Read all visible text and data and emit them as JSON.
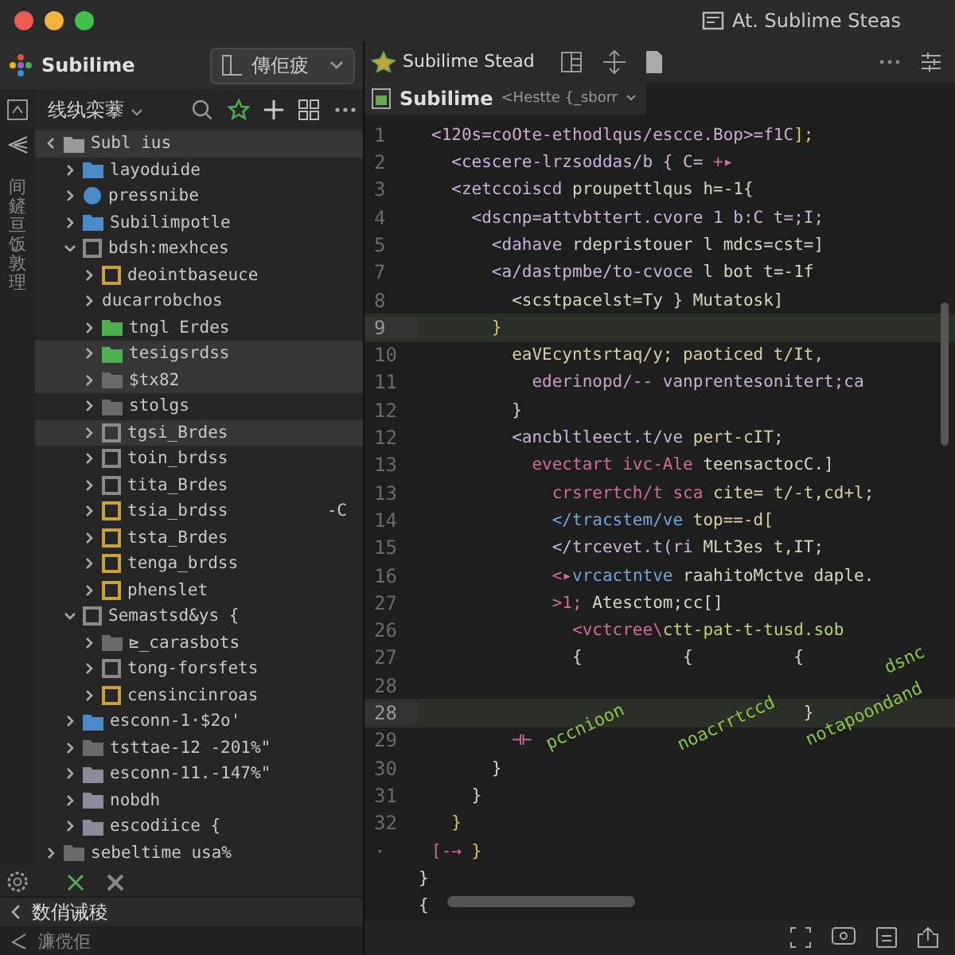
{
  "window": {
    "title": "At. Sublime Steas"
  },
  "sidebar": {
    "app_name": "Subilime",
    "switcher": {
      "label": "傳佢疲"
    },
    "section": {
      "label": "线纨栾藆"
    },
    "activity_label": "间鏟亘饭敦理",
    "tree": [
      {
        "label": "Subl ius",
        "kind": "root",
        "color": "#9a9a9a",
        "selected": true,
        "expanded": true,
        "children": [
          {
            "label": "layoduide",
            "kind": "folder",
            "color": "#4a8cc9",
            "selected": false,
            "expanded": false
          },
          {
            "label": "pressnibe",
            "kind": "dot",
            "color": "#4a8cc9",
            "selected": false,
            "expanded": false
          },
          {
            "label": "Subilimpotle",
            "kind": "folder",
            "color": "#4a8cc9",
            "selected": false,
            "expanded": false
          },
          {
            "label": "bdsh:mexhces",
            "kind": "outline",
            "color": "#8a8a8a",
            "selected": false,
            "expanded": true,
            "children": [
              {
                "label": "deointbaseuce",
                "kind": "outline",
                "color": "#c9a13b",
                "selected": false,
                "expanded": false
              },
              {
                "label": "ducarrobchos",
                "kind": "none",
                "selected": false,
                "expanded": false
              },
              {
                "label": "tngl Erdes",
                "kind": "folder",
                "color": "#4caf50",
                "selected": false,
                "expanded": false
              },
              {
                "label": "tesigsrdss",
                "kind": "folder",
                "color": "#4caf50",
                "selected": true,
                "expanded": false
              },
              {
                "label": "$tx82",
                "kind": "folder",
                "color": "#6a6a6a",
                "selected": true,
                "expanded": false
              },
              {
                "label": "stolgs",
                "kind": "folder",
                "color": "#6a6a6a",
                "selected": false,
                "expanded": false
              },
              {
                "label": "tgsi_Brdes",
                "kind": "outline",
                "color": "#8a8a8a",
                "selected": true,
                "expanded": false
              },
              {
                "label": "toin_brdss",
                "kind": "outline",
                "color": "#8a8a8a",
                "selected": false,
                "expanded": false
              },
              {
                "label": "tita_Brdes",
                "kind": "outline",
                "color": "#8a8a8a",
                "selected": false,
                "expanded": false
              },
              {
                "label": "tsia_brdss",
                "kind": "outline",
                "color": "#c9a13b",
                "selected": false,
                "expanded": false,
                "badge": "-C"
              },
              {
                "label": "tsta_Brdes",
                "kind": "outline",
                "color": "#c9a13b",
                "selected": false,
                "expanded": false
              },
              {
                "label": "tenga_brdss",
                "kind": "outline",
                "color": "#c9a13b",
                "selected": false,
                "expanded": false
              },
              {
                "label": "phenslet",
                "kind": "outline",
                "color": "#c9a13b",
                "selected": false,
                "expanded": false
              }
            ]
          },
          {
            "label": "Semastsd&ys {",
            "kind": "outline",
            "color": "#8a8a8a",
            "selected": false,
            "expanded": true,
            "children": [
              {
                "label": "⊵_carasbots",
                "kind": "folder",
                "color": "#6a6a6a",
                "selected": false,
                "expanded": false
              },
              {
                "label": "tong-forsfets",
                "kind": "outline",
                "color": "#8a8a8a",
                "selected": false,
                "expanded": false
              },
              {
                "label": "censincinroas",
                "kind": "outline",
                "color": "#c9a13b",
                "selected": false,
                "expanded": false
              }
            ]
          },
          {
            "label": "esconn-1·$2o'",
            "kind": "folder",
            "color": "#4a8cc9",
            "selected": false,
            "expanded": false
          },
          {
            "label": "tsttae-12 -201%\"",
            "kind": "folder",
            "color": "#6a6a6a",
            "selected": false,
            "expanded": false
          },
          {
            "label": "esconn-11.-147%\"",
            "kind": "folder",
            "color": "#8a8a9a",
            "selected": false,
            "expanded": false
          },
          {
            "label": "nobdh",
            "kind": "folder",
            "color": "#8a8a9a",
            "selected": false,
            "expanded": false
          },
          {
            "label": "escodiice {",
            "kind": "folder",
            "color": "#8a8a9a",
            "selected": false,
            "expanded": false
          }
        ]
      },
      {
        "label": "sebeltime usa%",
        "kind": "folder",
        "color": "#6a6a6a",
        "selected": false,
        "expanded": false
      }
    ],
    "panel_tab": "数俏诫稜",
    "status": "濂傥佢"
  },
  "editor": {
    "tab": "Subilime Stead",
    "breadcrumb": {
      "file": "Subilime",
      "path": "<Hestte {_sborr"
    },
    "lines": [
      {
        "num": "1",
        "current": false,
        "tokens": [
          {
            "text": "<120s=coOte-ethodlqus/escce.Bop>=f1C",
            "color": "#d0a8d0"
          },
          {
            "text": "];",
            "color": "#d9c46a"
          }
        ]
      },
      {
        "num": "2",
        "current": false,
        "tokens": [
          {
            "text": "  <cescere-lrzsoddas/b { C=",
            "color": "#c9b3d9"
          },
          {
            "text": " +▸",
            "color": "#d36b9f"
          }
        ]
      },
      {
        "num": "3",
        "current": false,
        "tokens": [
          {
            "text": "  <zetccoiscd",
            "color": "#c9b3d9"
          },
          {
            "text": " proupettlqus h=-1{",
            "color": "#d8d6c0"
          }
        ]
      },
      {
        "num": "4",
        "current": false,
        "tokens": [
          {
            "text": "    <dscnp=attvbttert.cvore 1 b:C t=;I;",
            "color": "#c9b3d9"
          }
        ]
      },
      {
        "num": "5",
        "current": false,
        "tokens": [
          {
            "text": "      <dahave",
            "color": "#c9b3d9"
          },
          {
            "text": " rdepristouer l mdcs=cst=]",
            "color": "#d8d6c0"
          }
        ]
      },
      {
        "num": "7",
        "current": false,
        "tokens": [
          {
            "text": "      <a/dastpmbe/to-cvoce",
            "color": "#c9b3d9"
          },
          {
            "text": " l bot t=-1f",
            "color": "#d8d6c0"
          }
        ]
      },
      {
        "num": "8",
        "current": false,
        "tokens": [
          {
            "text": "        <scstpacelst=Ty } Mutatosk]",
            "color": "#d8d6c0"
          }
        ]
      },
      {
        "num": "9",
        "current": true,
        "tokens": [
          {
            "text": "      }",
            "color": "#d9c46a"
          }
        ]
      },
      {
        "num": "10",
        "current": false,
        "tokens": [
          {
            "text": "        eaVEcyntsrtaq/y; paoticed t/It,",
            "color": "#d9d0a0"
          }
        ]
      },
      {
        "num": "11",
        "current": false,
        "tokens": [
          {
            "text": "          ederinopd/--",
            "color": "#c9a0c9"
          },
          {
            "text": " vanprentesonitert;ca",
            "color": "#c9b3d9"
          }
        ]
      },
      {
        "num": "12",
        "current": false,
        "tokens": [
          {
            "text": "        }",
            "color": "#d8d6c0"
          }
        ]
      },
      {
        "num": "12",
        "current": false,
        "tokens": [
          {
            "text": "        <ancbltleect.t/ve",
            "color": "#c9b3d9"
          },
          {
            "text": " pert-cIT;",
            "color": "#d9d0a0"
          }
        ]
      },
      {
        "num": "13",
        "current": false,
        "tokens": [
          {
            "text": "          evectart ivc-Ale",
            "color": "#d36b9f"
          },
          {
            "text": " teensactocC.]",
            "color": "#d8d6c0"
          }
        ]
      },
      {
        "num": "13",
        "current": false,
        "tokens": [
          {
            "text": "            crsrertch/t sca",
            "color": "#d36b9f"
          },
          {
            "text": " cite= t/-t,cd+l;",
            "color": "#d9d0a0"
          }
        ]
      },
      {
        "num": "14",
        "current": false,
        "tokens": [
          {
            "text": "            </tracstem/ve",
            "color": "#6fa8dc"
          },
          {
            "text": " top==-d[",
            "color": "#d9d0a0"
          }
        ]
      },
      {
        "num": "15",
        "current": false,
        "tokens": [
          {
            "text": "            </trcevet.t(ri",
            "color": "#c9b3d9"
          },
          {
            "text": " MLt3es t,IT;",
            "color": "#d8d6c0"
          }
        ]
      },
      {
        "num": "16",
        "current": false,
        "tokens": [
          {
            "text": "            <▸",
            "color": "#d36b9f"
          },
          {
            "text": "vrcactntve",
            "color": "#6fa8dc"
          },
          {
            "text": " raahitoMctve daple.",
            "color": "#d8d6c0"
          }
        ]
      },
      {
        "num": "27",
        "current": false,
        "tokens": [
          {
            "text": "            >1;",
            "color": "#d36b9f"
          },
          {
            "text": " Atesctom;cc[]",
            "color": "#d8d6c0"
          }
        ]
      },
      {
        "num": "26",
        "current": false,
        "tokens": [
          {
            "text": "              <vctcree\\",
            "color": "#d36b9f"
          },
          {
            "text": "ctt-pat-t-tusd.sob",
            "color": "#b5d86a"
          }
        ]
      },
      {
        "num": "27",
        "current": false,
        "tokens": [
          {
            "text": "              {          {          {",
            "color": "#d8d6c0"
          }
        ]
      },
      {
        "num": "28",
        "current": false
      },
      {
        "num": "28",
        "current": true,
        "tokens": [
          {
            "text": "                                     }",
            "color": "#d8d6c0"
          }
        ]
      },
      {
        "num": "29",
        "current": false,
        "tokens": [
          {
            "text": "        ⊣⊢",
            "color": "#d36b9f"
          }
        ]
      },
      {
        "num": "30",
        "current": false,
        "tokens": [
          {
            "text": "      }",
            "color": "#d8d6c0"
          }
        ]
      },
      {
        "num": "31",
        "current": false,
        "tokens": [
          {
            "text": "    }",
            "color": "#d8d6c0"
          }
        ]
      },
      {
        "num": "32",
        "current": false,
        "tokens": [
          {
            "text": "  }",
            "color": "#d9c46a"
          }
        ]
      },
      {
        "num": "·",
        "current": false,
        "tokens": [
          {
            "text": "[-→",
            "color": "#d36b9f"
          },
          {
            "text": " }",
            "color": "#d9c46a"
          }
        ]
      }
    ],
    "trailing": [
      "}",
      "{"
    ],
    "annotations": [
      "pccnioon",
      "noacrrtccd",
      "notapoondand",
      "dsnc"
    ]
  }
}
